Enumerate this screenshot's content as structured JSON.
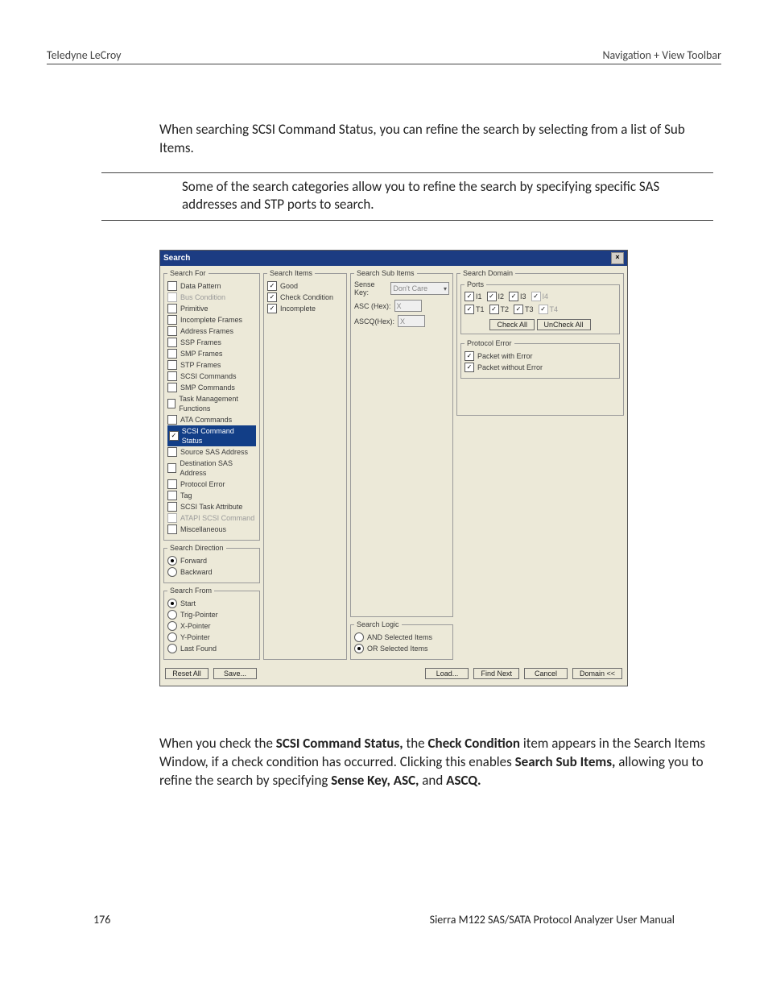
{
  "header": {
    "left": "Teledyne LeCroy",
    "right": "Navigation + View Toolbar"
  },
  "intro": "When searching SCSI Command Status, you can refine the search by selecting from a list of Sub Items.",
  "mid": "Some of the search categories allow you to refine the search by specifying specific SAS addresses and STP ports to search.",
  "dialog": {
    "title": "Search",
    "searchFor": {
      "legend": "Search For",
      "items": [
        {
          "label": "Data Pattern",
          "checked": false,
          "disabled": false
        },
        {
          "label": "Bus Condition",
          "checked": false,
          "disabled": true
        },
        {
          "label": "Primitive",
          "checked": false,
          "disabled": false
        },
        {
          "label": "Incomplete Frames",
          "checked": false,
          "disabled": false
        },
        {
          "label": "Address Frames",
          "checked": false,
          "disabled": false
        },
        {
          "label": "SSP Frames",
          "checked": false,
          "disabled": false
        },
        {
          "label": "SMP Frames",
          "checked": false,
          "disabled": false
        },
        {
          "label": "STP Frames",
          "checked": false,
          "disabled": false
        },
        {
          "label": "SCSI Commands",
          "checked": false,
          "disabled": false
        },
        {
          "label": "SMP Commands",
          "checked": false,
          "disabled": false
        },
        {
          "label": "Task Management Functions",
          "checked": false,
          "disabled": false
        },
        {
          "label": "ATA Commands",
          "checked": false,
          "disabled": false
        },
        {
          "label": "SCSI Command Status",
          "checked": true,
          "disabled": false,
          "selected": true
        },
        {
          "label": "Source SAS Address",
          "checked": false,
          "disabled": false
        },
        {
          "label": "Destination SAS Address",
          "checked": false,
          "disabled": false
        },
        {
          "label": "Protocol Error",
          "checked": false,
          "disabled": false
        },
        {
          "label": "Tag",
          "checked": false,
          "disabled": false
        },
        {
          "label": "SCSI Task Attribute",
          "checked": false,
          "disabled": false
        },
        {
          "label": "ATAPI SCSI Command",
          "checked": false,
          "disabled": true
        },
        {
          "label": "Miscellaneous",
          "checked": false,
          "disabled": false
        }
      ]
    },
    "searchDirection": {
      "legend": "Search Direction",
      "options": [
        "Forward",
        "Backward"
      ],
      "selected": "Forward"
    },
    "searchFrom": {
      "legend": "Search From",
      "options": [
        "Start",
        "Trig-Pointer",
        "X-Pointer",
        "Y-Pointer",
        "Last Found"
      ],
      "selected": "Start"
    },
    "searchItems": {
      "legend": "Search Items",
      "items": [
        {
          "label": "Good",
          "checked": true
        },
        {
          "label": "Check Condition",
          "checked": true
        },
        {
          "label": "Incomplete",
          "checked": true
        }
      ]
    },
    "searchSubItems": {
      "legend": "Search Sub Items",
      "senseKeyLabel": "Sense Key:",
      "senseKeyValue": "Don't Care",
      "ascLabel": "ASC (Hex):",
      "ascValue": "X",
      "ascqLabel": "ASCQ(Hex):",
      "ascqValue": "X"
    },
    "searchLogic": {
      "legend": "Search Logic",
      "options": [
        "AND Selected Items",
        "OR Selected Items"
      ],
      "selected": "OR Selected Items"
    },
    "searchDomain": {
      "legend": "Search Domain",
      "portsLegend": "Ports",
      "row1": [
        {
          "label": "I1",
          "checked": true,
          "disabled": false
        },
        {
          "label": "I2",
          "checked": true,
          "disabled": false
        },
        {
          "label": "I3",
          "checked": true,
          "disabled": false
        },
        {
          "label": "I4",
          "checked": true,
          "disabled": true
        }
      ],
      "row2": [
        {
          "label": "T1",
          "checked": true,
          "disabled": false
        },
        {
          "label": "T2",
          "checked": true,
          "disabled": false
        },
        {
          "label": "T3",
          "checked": true,
          "disabled": false
        },
        {
          "label": "T4",
          "checked": true,
          "disabled": true
        }
      ],
      "checkAll": "Check All",
      "uncheckAll": "UnCheck All",
      "protocolLegend": "Protocol Error",
      "pe1": {
        "label": "Packet with Error",
        "checked": true
      },
      "pe2": {
        "label": "Packet without Error",
        "checked": true
      }
    },
    "buttons": {
      "resetAll": "Reset All",
      "save": "Save...",
      "load": "Load...",
      "findNext": "Find Next",
      "cancel": "Cancel",
      "domain": "Domain <<"
    }
  },
  "explain": {
    "pre": "When you check the ",
    "b1": "SCSI Command Status,",
    "mid1": " the ",
    "b2": "Check Condition",
    "mid2": " item appears in the Search Items Window, if a check condition has occurred. Clicking this enables ",
    "b3": "Search Sub Items,",
    "mid3": " allowing you to refine the search by specifying ",
    "b4": "Sense Key, ASC,",
    "mid4": " and ",
    "b5": "ASCQ.",
    "post": ""
  },
  "footer": {
    "page": "176",
    "manual": "Sierra M122 SAS/SATA Protocol Analyzer User Manual"
  }
}
